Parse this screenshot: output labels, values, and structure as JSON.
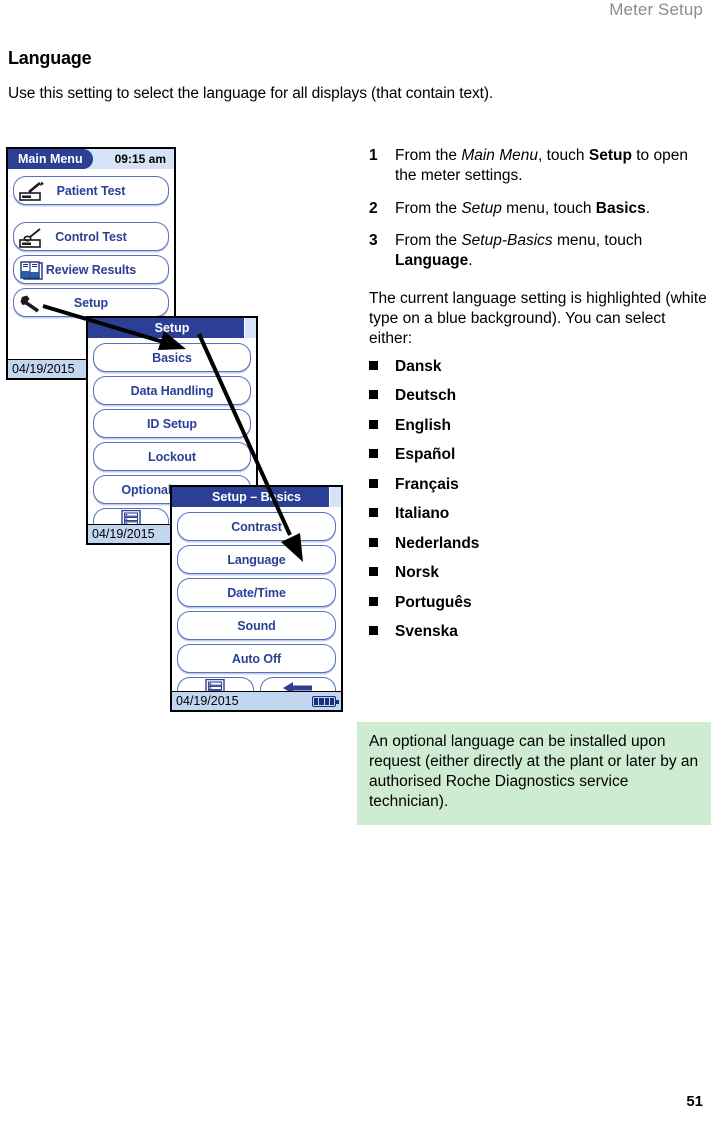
{
  "running_head": "Meter Setup",
  "page_number": "51",
  "section": {
    "title": "Language",
    "intro": "Use this setting to select the language for all displays (that contain text)."
  },
  "steps": [
    {
      "num": "1",
      "parts": [
        {
          "t": "From the ",
          "style": "normal"
        },
        {
          "t": "Main Menu",
          "style": "italic"
        },
        {
          "t": ", touch ",
          "style": "normal"
        },
        {
          "t": "Setup",
          "style": "bold"
        },
        {
          "t": " to open the meter settings.",
          "style": "normal"
        }
      ]
    },
    {
      "num": "2",
      "parts": [
        {
          "t": "From the ",
          "style": "normal"
        },
        {
          "t": "Setup",
          "style": "italic"
        },
        {
          "t": " menu, touch ",
          "style": "normal"
        },
        {
          "t": "Basics",
          "style": "bold"
        },
        {
          "t": ".",
          "style": "normal"
        }
      ]
    },
    {
      "num": "3",
      "parts": [
        {
          "t": "From the ",
          "style": "normal"
        },
        {
          "t": "Setup-Basics",
          "style": "italic"
        },
        {
          "t": " menu, touch ",
          "style": "normal"
        },
        {
          "t": "Language",
          "style": "bold"
        },
        {
          "t": ".",
          "style": "normal"
        }
      ]
    }
  ],
  "paragraph": "The current language setting is highlighted (white type on a blue background). You can select either:",
  "languages": [
    "Dansk",
    "Deutsch",
    "English",
    "Español",
    "Français",
    "Italiano",
    "Nederlands",
    "Norsk",
    "Português",
    "Svenska"
  ],
  "note": "An optional language can be installed upon request (either directly at the plant or later by an authorised Roche Diagnostics service technician).",
  "screens": {
    "main_menu": {
      "title": "Main Menu",
      "clock": "09:15 am",
      "date": "04/19/2015",
      "buttons": [
        {
          "label": "Patient Test",
          "icon": "lancet-strip-icon"
        },
        {
          "label": "Control Test",
          "icon": "control-vial-strip-icon"
        },
        {
          "label": "Review Results",
          "icon": "review-book-icon"
        },
        {
          "label": "Setup",
          "icon": "wrench-icon"
        }
      ]
    },
    "setup": {
      "title": "Setup",
      "date": "04/19/2015",
      "buttons": [
        {
          "label": "Basics"
        },
        {
          "label": "Data Handling"
        },
        {
          "label": "ID Setup"
        },
        {
          "label": "Lockout"
        },
        {
          "label": "Optional Screens"
        }
      ],
      "footer_buttons": [
        {
          "icon": "main-menu-list-icon"
        }
      ]
    },
    "setup_basics": {
      "title": "Setup – Basics",
      "date": "04/19/2015",
      "buttons": [
        {
          "label": "Contrast"
        },
        {
          "label": "Language"
        },
        {
          "label": "Date/Time"
        },
        {
          "label": "Sound"
        },
        {
          "label": "Auto Off"
        }
      ],
      "footer_buttons": [
        {
          "icon": "main-menu-list-icon"
        },
        {
          "icon": "back-arrow-icon"
        }
      ],
      "battery": "battery-full-icon"
    }
  },
  "colors": {
    "header_blue": "#2b3f95",
    "light_blue": "#d6e2f5",
    "footer_blue": "#c3d6ef",
    "button_border": "#5a6fbe",
    "note_green": "#cdecd2",
    "running_head_gray": "#8d8d8d"
  }
}
